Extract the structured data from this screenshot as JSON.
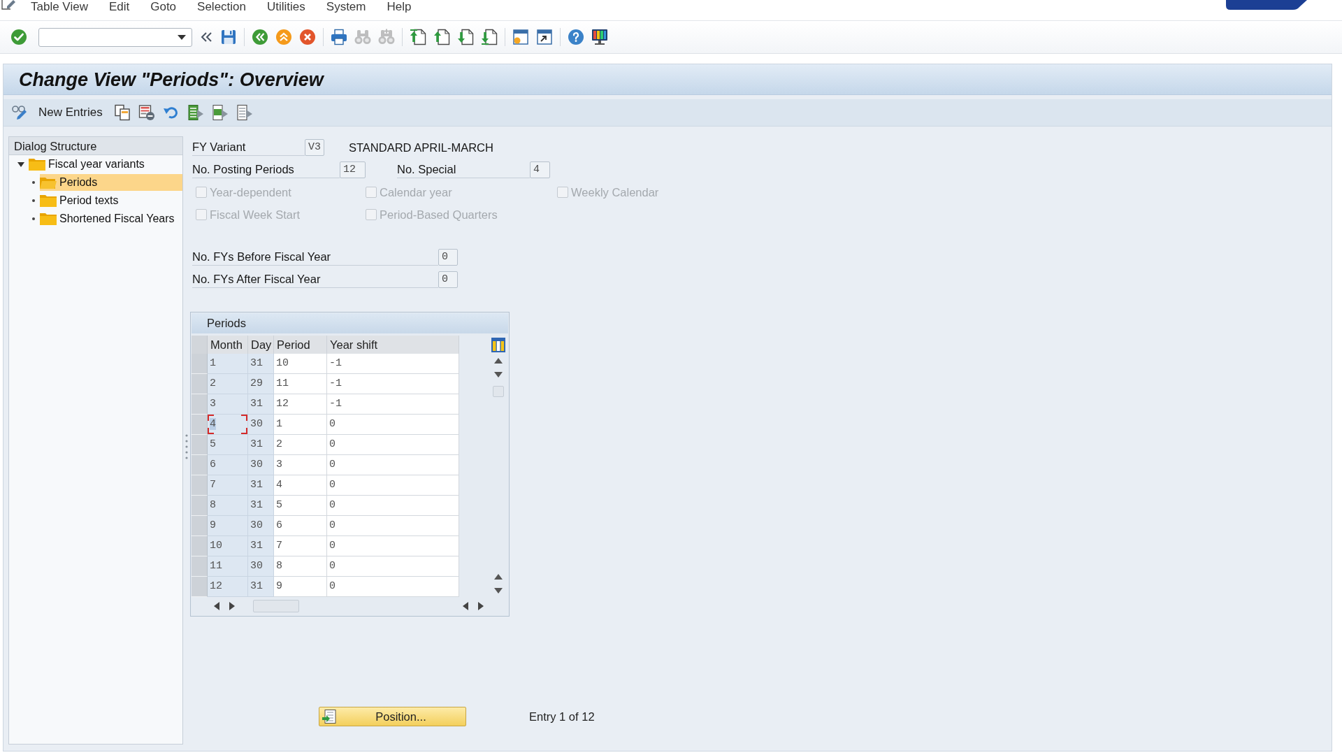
{
  "menu": [
    "Table View",
    "Edit",
    "Goto",
    "Selection",
    "Utilities",
    "System",
    "Help"
  ],
  "standard_toolbar": [
    {
      "kind": "enter",
      "disabled": false
    },
    {
      "kind": "command"
    },
    {
      "kind": "collapse",
      "disabled": false
    },
    {
      "kind": "save",
      "disabled": false
    },
    {
      "kind": "separator"
    },
    {
      "kind": "back",
      "disabled": false
    },
    {
      "kind": "exit",
      "disabled": false
    },
    {
      "kind": "cancel",
      "disabled": false
    },
    {
      "kind": "separator"
    },
    {
      "kind": "print",
      "disabled": false
    },
    {
      "kind": "find",
      "disabled": true
    },
    {
      "kind": "findnext",
      "disabled": true
    },
    {
      "kind": "separator"
    },
    {
      "kind": "firstpage",
      "disabled": false
    },
    {
      "kind": "prevpage",
      "disabled": false
    },
    {
      "kind": "nextpage",
      "disabled": false
    },
    {
      "kind": "lastpage",
      "disabled": false
    },
    {
      "kind": "separator"
    },
    {
      "kind": "session",
      "disabled": false
    },
    {
      "kind": "shortcut",
      "disabled": false
    },
    {
      "kind": "separator"
    },
    {
      "kind": "help",
      "disabled": false
    },
    {
      "kind": "layout",
      "disabled": false
    }
  ],
  "title": "Change View \"Periods\": Overview",
  "application_toolbar": [
    {
      "kind": "toggle"
    },
    {
      "kind": "button",
      "label": "New Entries"
    },
    {
      "kind": "copy"
    },
    {
      "kind": "delete"
    },
    {
      "kind": "undo"
    },
    {
      "kind": "selectall"
    },
    {
      "kind": "selectblock"
    },
    {
      "kind": "deselect"
    }
  ],
  "dialog_structure": {
    "title": "Dialog Structure",
    "items": [
      {
        "label": "Fiscal year variants",
        "selected": false,
        "expanded": true,
        "children": [
          {
            "label": "Periods",
            "selected": true
          },
          {
            "label": "Period texts",
            "selected": false
          },
          {
            "label": "Shortened Fiscal Years",
            "selected": false
          }
        ]
      }
    ]
  },
  "fy_variant": {
    "label": "FY Variant",
    "value": "V3",
    "description": "STANDARD APRIL-MARCH"
  },
  "posting_periods": {
    "label": "No. Posting Periods",
    "value": "12"
  },
  "special_periods": {
    "label": "No. Special",
    "value": "4"
  },
  "checkboxes": [
    {
      "label": "Year-dependent",
      "checked": false,
      "disabled": true
    },
    {
      "label": "Calendar year",
      "checked": false,
      "disabled": true
    },
    {
      "label": "Weekly Calendar",
      "checked": false,
      "disabled": true
    },
    {
      "label": "Fiscal Week Start",
      "checked": false,
      "disabled": true
    },
    {
      "label": "Period-Based Quarters",
      "checked": false,
      "disabled": true
    }
  ],
  "fys_before": {
    "label": "No. FYs Before Fiscal Year",
    "value": "0"
  },
  "fys_after": {
    "label": "No. FYs After Fiscal Year",
    "value": "0"
  },
  "periods_table": {
    "title": "Periods",
    "columns": [
      "Month",
      "Day",
      "Period",
      "Year shift"
    ],
    "rows": [
      {
        "cells": [
          "1",
          "31",
          "10",
          "-1"
        ],
        "selected": false,
        "focused": false
      },
      {
        "cells": [
          "2",
          "29",
          "11",
          "-1"
        ],
        "selected": false,
        "focused": false
      },
      {
        "cells": [
          "3",
          "31",
          "12",
          "-1"
        ],
        "selected": false,
        "focused": false
      },
      {
        "cells": [
          "4",
          "30",
          "1",
          "0"
        ],
        "selected": false,
        "focused": true
      },
      {
        "cells": [
          "5",
          "31",
          "2",
          "0"
        ],
        "selected": false,
        "focused": false
      },
      {
        "cells": [
          "6",
          "30",
          "3",
          "0"
        ],
        "selected": false,
        "focused": false
      },
      {
        "cells": [
          "7",
          "31",
          "4",
          "0"
        ],
        "selected": false,
        "focused": false
      },
      {
        "cells": [
          "8",
          "31",
          "5",
          "0"
        ],
        "selected": false,
        "focused": false
      },
      {
        "cells": [
          "9",
          "30",
          "6",
          "0"
        ],
        "selected": false,
        "focused": false
      },
      {
        "cells": [
          "10",
          "31",
          "7",
          "0"
        ],
        "selected": false,
        "focused": false
      },
      {
        "cells": [
          "11",
          "30",
          "8",
          "0"
        ],
        "selected": false,
        "focused": false
      },
      {
        "cells": [
          "12",
          "31",
          "9",
          "0"
        ],
        "selected": false,
        "focused": false
      }
    ]
  },
  "position_button": {
    "label": "Position..."
  },
  "entry_status": "Entry 1 of 12"
}
